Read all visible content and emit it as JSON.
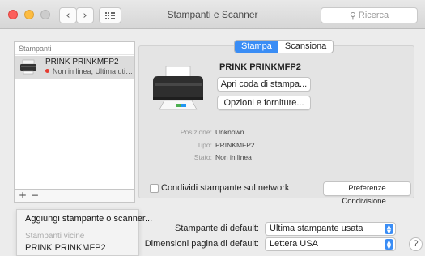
{
  "window": {
    "title": "Stampanti e Scanner",
    "search_placeholder": "Ricerca"
  },
  "icons": {
    "back": "chevron-left-icon",
    "forward": "chevron-right-icon",
    "grid": "grid-icon",
    "search": "search-icon",
    "printer": "printer-icon"
  },
  "sidebar": {
    "header": "Stampanti",
    "printers": [
      {
        "name": "PRINK PRINKMFP2",
        "status": "Non in linea, Ultima utili..."
      }
    ],
    "add_symbol": "+",
    "remove_symbol": "−"
  },
  "add_menu": {
    "add_label": "Aggiungi stampante o scanner...",
    "nearby_header": "Stampanti vicine",
    "nearby_printer": "PRINK PRINKMFP2"
  },
  "detail": {
    "tabs": [
      {
        "label": "Stampa",
        "active": true
      },
      {
        "label": "Scansiona",
        "active": false
      }
    ],
    "printer_name": "PRINK PRINKMFP2",
    "open_queue_label": "Apri coda di stampa...",
    "options_label": "Opzioni e forniture...",
    "info": [
      {
        "label": "Posizione:",
        "value": "Unknown"
      },
      {
        "label": "Tipo:",
        "value": "PRINKMFP2"
      },
      {
        "label": "Stato:",
        "value": "Non in linea"
      }
    ],
    "share_label": "Condividi stampante sul network",
    "share_checked": false,
    "share_prefs_label": "Preferenze Condivisione..."
  },
  "defaults": {
    "default_printer_label": "Stampante di default:",
    "default_printer_value": "Ultima stampante usata",
    "paper_size_label": "Dimensioni pagina di default:",
    "paper_size_value": "Lettera USA",
    "help_symbol": "?"
  },
  "colors": {
    "accent": "#3a8df5",
    "status_offline": "#e53b30"
  }
}
